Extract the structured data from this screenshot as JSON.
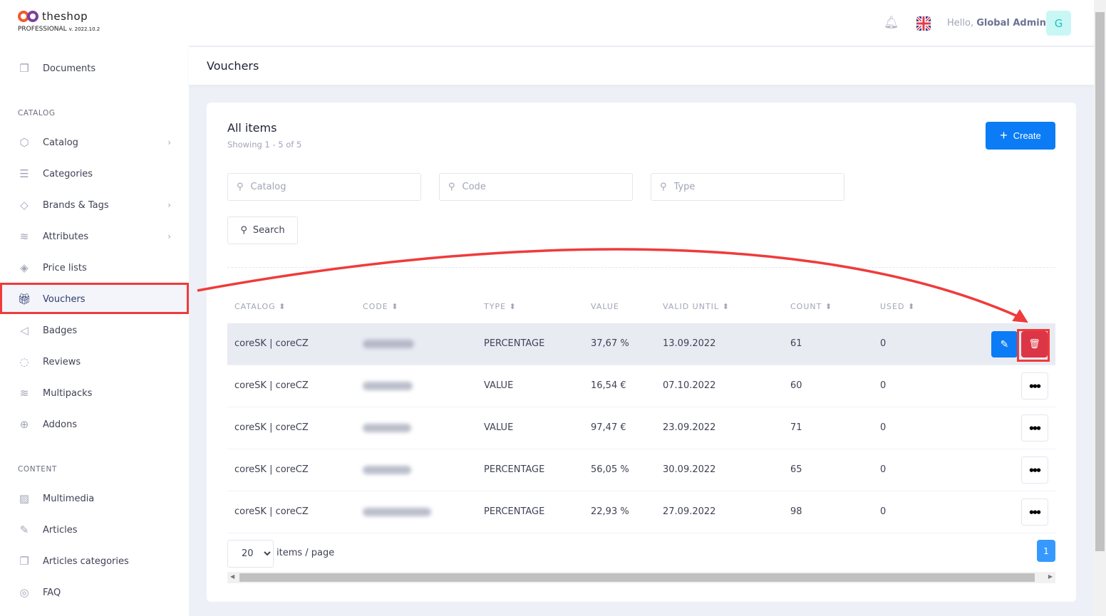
{
  "brand": {
    "name": "theshop",
    "edition": "PROFESSIONAL",
    "version": "v. 2022.10.2"
  },
  "colors": {
    "accent": "#0b7cf5",
    "danger": "#dc3545",
    "annotation": "#ef3b3b"
  },
  "sidebar": {
    "top": [
      {
        "label": "Documents",
        "icon": "documents-icon"
      }
    ],
    "sections": [
      {
        "title": "CATALOG",
        "items": [
          {
            "label": "Catalog",
            "icon": "box-icon",
            "chevron": true
          },
          {
            "label": "Categories",
            "icon": "list-icon"
          },
          {
            "label": "Brands & Tags",
            "icon": "tag-icon",
            "chevron": true
          },
          {
            "label": "Attributes",
            "icon": "layers-icon",
            "chevron": true
          },
          {
            "label": "Price lists",
            "icon": "price-icon"
          },
          {
            "label": "Vouchers",
            "icon": "gift-icon",
            "active": true
          },
          {
            "label": "Badges",
            "icon": "megaphone-icon"
          },
          {
            "label": "Reviews",
            "icon": "chat-icon"
          },
          {
            "label": "Multipacks",
            "icon": "stack-icon"
          },
          {
            "label": "Addons",
            "icon": "plus-circle-icon"
          }
        ]
      },
      {
        "title": "CONTENT",
        "items": [
          {
            "label": "Multimedia",
            "icon": "image-icon"
          },
          {
            "label": "Articles",
            "icon": "edit-icon"
          },
          {
            "label": "Articles categories",
            "icon": "folders-icon"
          },
          {
            "label": "FAQ",
            "icon": "help-icon"
          }
        ]
      }
    ]
  },
  "header": {
    "greeting": "Hello,",
    "user": "Global Admin",
    "avatar_letter": "G",
    "language": "EN"
  },
  "page": {
    "title": "Vouchers"
  },
  "card": {
    "title": "All items",
    "showing": "Showing 1 - 5 of 5",
    "create_label": "Create",
    "filters": {
      "catalog": "Catalog",
      "code": "Code",
      "type": "Type"
    },
    "search_label": "Search"
  },
  "table": {
    "columns": [
      "CATALOG",
      "CODE",
      "TYPE",
      "VALUE",
      "VALID UNTIL",
      "COUNT",
      "USED"
    ],
    "rows": [
      {
        "catalog": "coreSK | coreCZ",
        "type": "PERCENTAGE",
        "value": "37,67 %",
        "valid": "13.09.2022",
        "count": "61",
        "used": "0"
      },
      {
        "catalog": "coreSK | coreCZ",
        "type": "VALUE",
        "value": "16,54 €",
        "valid": "07.10.2022",
        "count": "60",
        "used": "0"
      },
      {
        "catalog": "coreSK | coreCZ",
        "type": "VALUE",
        "value": "97,47 €",
        "valid": "23.09.2022",
        "count": "71",
        "used": "0"
      },
      {
        "catalog": "coreSK | coreCZ",
        "type": "PERCENTAGE",
        "value": "56,05 %",
        "valid": "30.09.2022",
        "count": "65",
        "used": "0"
      },
      {
        "catalog": "coreSK | coreCZ",
        "type": "PERCENTAGE",
        "value": "22,93 %",
        "valid": "27.09.2022",
        "count": "98",
        "used": "0"
      }
    ]
  },
  "pagination": {
    "per_page": "20",
    "per_page_label": "items / page",
    "current_page": "1"
  }
}
